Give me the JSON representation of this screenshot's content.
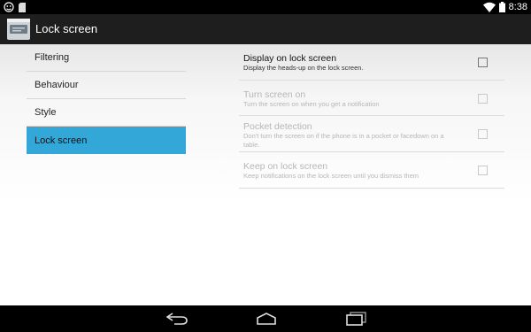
{
  "status_bar": {
    "time": "8:38",
    "left_icons": [
      "android-debug-icon",
      "sd-card-icon"
    ],
    "right_icons": [
      "wifi-icon",
      "battery-icon"
    ]
  },
  "action_bar": {
    "title": "Lock screen",
    "icon": "notification-app-icon"
  },
  "sidebar": {
    "items": [
      {
        "label": "Filtering",
        "selected": false
      },
      {
        "label": "Behaviour",
        "selected": false
      },
      {
        "label": "Style",
        "selected": false
      },
      {
        "label": "Lock screen",
        "selected": true
      }
    ],
    "selected_color": "#33a8d8"
  },
  "preferences": [
    {
      "title": "Display on lock screen",
      "summary": "Display the heads-up on the lock screen.",
      "enabled": true,
      "checked": false
    },
    {
      "title": "Turn screen on",
      "summary": "Turn the screen on when you get a notification",
      "enabled": false,
      "checked": false
    },
    {
      "title": "Pocket detection",
      "summary": "Don't turn the screen on if the phone is in a pocket or facedown on a table.",
      "enabled": false,
      "checked": false
    },
    {
      "title": "Keep on lock screen",
      "summary": "Keep notifications on the lock screen until you dismiss them",
      "enabled": false,
      "checked": false
    }
  ],
  "nav_bar": {
    "buttons": [
      "back-icon",
      "home-icon",
      "recents-icon"
    ]
  }
}
